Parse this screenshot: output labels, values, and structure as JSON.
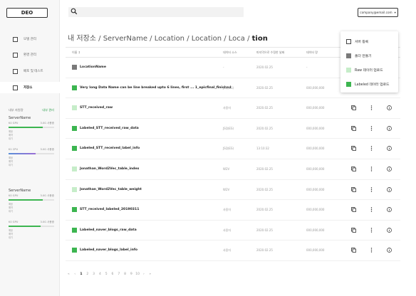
{
  "logo": "DEO",
  "sidebar": {
    "nav": [
      {
        "label": "모델 관리"
      },
      {
        "label": "환경 관리"
      },
      {
        "label": "배포 및 테스트"
      },
      {
        "label": "저장소"
      }
    ],
    "sys_title": "내부 자원량",
    "sys_link": "내부 관리",
    "servers": [
      {
        "name": "ServerName",
        "groups": [
          {
            "label": "K0 GPU",
            "value": "3.0G 사용중",
            "fill": 0.75,
            "details": [
              "예정",
              "예약",
              "대기"
            ]
          },
          {
            "label": "K1 CPU",
            "value": "3.0G 사용중",
            "fill": 0.6,
            "details": [
              "예정",
              "예약",
              "대기"
            ]
          }
        ]
      },
      {
        "name": "ServerName",
        "groups": [
          {
            "label": "K0 GPU",
            "value": "3.0G 사용중",
            "fill": 0.75,
            "details": [
              "예정",
              "예약",
              "대기"
            ]
          },
          {
            "label": "K0 GPU",
            "value": "3.0G 사용중",
            "fill": 0.7,
            "details": [
              "예정",
              "예약",
              "대기"
            ]
          }
        ]
      }
    ]
  },
  "topbar": {
    "account": "company@email.com",
    "account_caret": "▾"
  },
  "breadcrumb": {
    "path": "내 저장소 / ServerName / Location / Location / Loca / ",
    "current": "tion"
  },
  "table": {
    "headers": [
      "이름 ↕",
      "데이터 소스",
      "마지막으로 수정한 날짜",
      "데이터 량"
    ],
    "rows": [
      {
        "name": "LocationName",
        "source": "-",
        "date": "2020.02.25",
        "size": "-",
        "type": "folder",
        "actions": false
      },
      {
        "name": "Very long Data Name can be line breaked upto 6 lines, first ... 1_epicfinal_finished",
        "source": "JSQ(ES)",
        "date": "2020.02.25",
        "size": "000,000,000",
        "type": "labeled",
        "actions": false
      },
      {
        "name": "STT_received_raw",
        "source": "사용자",
        "date": "2020.02.25",
        "size": "000,000,000",
        "type": "raw",
        "actions": true
      },
      {
        "name": "Labeled_STT_received_raw_data",
        "source": "JSQ(ES)",
        "date": "2020.02.25",
        "size": "000,000,000",
        "type": "labeled",
        "actions": true
      },
      {
        "name": "Labeled_STT_received_label_info",
        "source": "JSQ(ES)",
        "date": "13:10:32",
        "size": "000,000,000",
        "type": "labeled",
        "actions": true
      },
      {
        "name": "Jonathan_Word2Vec_table_index",
        "source": "W2V",
        "date": "2020.02.25",
        "size": "000,000,000",
        "type": "raw",
        "actions": true
      },
      {
        "name": "Jonathan_Word2Vec_table_weight",
        "source": "W2V",
        "date": "2020.02.25",
        "size": "000,000,000",
        "type": "raw",
        "actions": true
      },
      {
        "name": "STT_received_labeled_20190311",
        "source": "사용자",
        "date": "2020.02.25",
        "size": "000,000,000",
        "type": "labeled",
        "actions": true
      },
      {
        "name": "Labeled_naver_blogs_raw_data",
        "source": "사용자",
        "date": "2020.02.25",
        "size": "000,000,000",
        "type": "labeled",
        "actions": true
      },
      {
        "name": "Labeled_naver_blogs_label_info",
        "source": "사용자",
        "date": "2020.02.25",
        "size": "000,000,000",
        "type": "labeled",
        "actions": true
      }
    ]
  },
  "pager": {
    "first": "«",
    "prev": "‹",
    "pages": [
      "1",
      "2",
      "3",
      "4",
      "5",
      "6",
      "7",
      "8",
      "9",
      "10"
    ],
    "current": "1",
    "next": "›",
    "last": "»"
  },
  "menu": {
    "items": [
      {
        "label": "서버 등록",
        "type": "server"
      },
      {
        "label": "폴더 만들기",
        "type": "folder"
      },
      {
        "label": "Raw 데이터 업로드",
        "type": "raw"
      },
      {
        "label": "Labeled 데이터 업로드",
        "type": "labeled"
      }
    ]
  },
  "colors": {
    "folder": "#7a7a7a",
    "labeled": "#3cb550",
    "raw": "#c6edc9",
    "bar_green": "#3cb550",
    "bar_blue": "#5a8fd8",
    "bar_purple": "#9b6fd6"
  },
  "icons": {
    "search": "search-icon",
    "copy": "copy-icon",
    "more": "more-icon",
    "info": "info-icon"
  }
}
